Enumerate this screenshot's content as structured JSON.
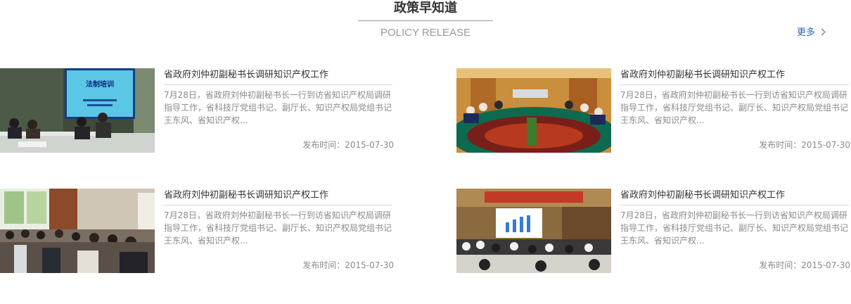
{
  "section": {
    "title": "政策早知道",
    "subtitle": "POLICY RELEASE",
    "more_label": "更多"
  },
  "articles": [
    {
      "image": "meeting-training-photo",
      "image_caption": "法制培训",
      "title": "省政府刘仲初副秘书长调研知识产权工作",
      "summary": "7月28日，省政府刘仲初副秘书长一行到访省知识产权局调研指导工作，省科技厅党组书记、副厅长、知识产权局党组书记王东风、省知识产权...",
      "date": "发布时间：2015-07-30"
    },
    {
      "image": "conference-table-photo",
      "title": "省政府刘仲初副秘书长调研知识产权工作",
      "summary": "7月28日，省政府刘仲初副秘书长一行到访省知识产权局调研指导工作，省科技厅党组书记、副厅长、知识产权局党组书记王东风、省知识产权...",
      "date": "发布时间：2015-07-30"
    },
    {
      "image": "classroom-audience-photo",
      "title": "省政府刘仲初副秘书长调研知识产权工作",
      "summary": "7月28日，省政府刘仲初副秘书长一行到访省知识产权局调研指导工作，省科技厅党组书记、副厅长、知识产权局党组书记王东风、省知识产权...",
      "date": "发布时间：2015-07-30"
    },
    {
      "image": "auditorium-presentation-photo",
      "title": "省政府刘仲初副秘书长调研知识产权工作",
      "summary": "7月28日，省政府刘仲初副秘书长一行到访省知识产权局调研指导工作，省科技厅党组书记、副厅长、知识产权局党组书记王东风、省知识产权...",
      "date": "发布时间：2015-07-30"
    }
  ],
  "colors": {
    "accent": "#2a66b5",
    "text": "#333333",
    "muted": "#8a8a8a"
  }
}
